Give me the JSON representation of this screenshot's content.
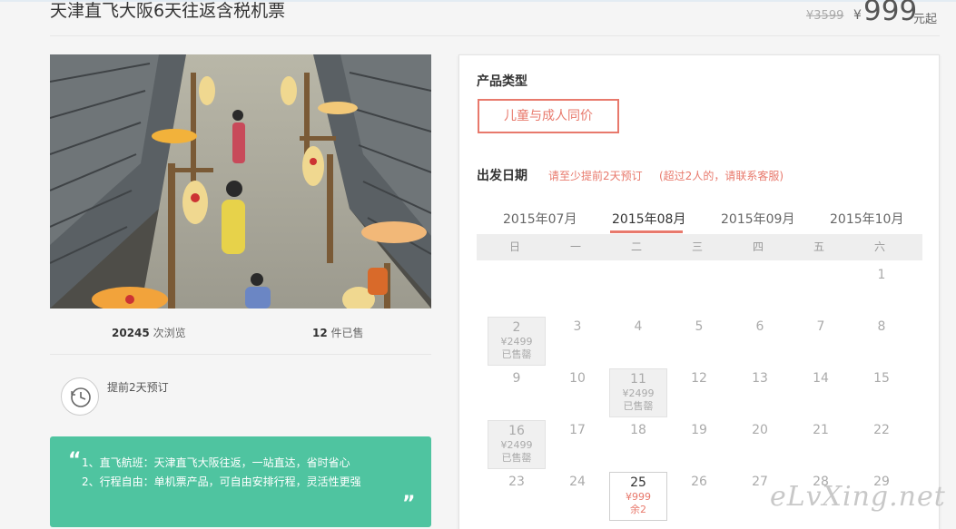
{
  "header": {
    "title": "天津直飞大阪6天往返含税机票",
    "old_price": "¥3599",
    "yen": "¥",
    "price": "999",
    "price_unit": "元起"
  },
  "stats": {
    "views_num": "20245",
    "views_label": " 次浏览",
    "sold_num": "12",
    "sold_label": " 件已售"
  },
  "booking": {
    "note": "提前2天预订",
    "icon": "clock-icon"
  },
  "features": {
    "open_quote": "“",
    "close_quote": "”",
    "line1": "1、直飞航班：天津直飞大阪往返，一站直达，省时省心",
    "line2": "2、行程自由：单机票产品，可自由安排行程，灵活性更强"
  },
  "product": {
    "type_label": "产品类型",
    "type_option": "儿童与成人同价",
    "date_label": "出发日期",
    "date_note1": "请至少提前2天预订",
    "date_note2": "(超过2人的，请联系客服)"
  },
  "calendar": {
    "months": [
      "2015年07月",
      "2015年08月",
      "2015年09月",
      "2015年10月"
    ],
    "active_month": "2015年08月",
    "weekdays": [
      "日",
      "一",
      "二",
      "三",
      "四",
      "五",
      "六"
    ],
    "days": [
      {
        "day": "1"
      },
      {
        "day": "2",
        "price": "¥2499",
        "status": "已售罄"
      },
      {
        "day": "3"
      },
      {
        "day": "4"
      },
      {
        "day": "5"
      },
      {
        "day": "6"
      },
      {
        "day": "7"
      },
      {
        "day": "8"
      },
      {
        "day": "9"
      },
      {
        "day": "10"
      },
      {
        "day": "11",
        "price": "¥2499",
        "status": "已售罄"
      },
      {
        "day": "12"
      },
      {
        "day": "13"
      },
      {
        "day": "14"
      },
      {
        "day": "15"
      },
      {
        "day": "16",
        "price": "¥2499",
        "status": "已售罄"
      },
      {
        "day": "17"
      },
      {
        "day": "18"
      },
      {
        "day": "19"
      },
      {
        "day": "20"
      },
      {
        "day": "21"
      },
      {
        "day": "22"
      },
      {
        "day": "23"
      },
      {
        "day": "24"
      },
      {
        "day": "25",
        "price": "¥999",
        "status": "余2"
      },
      {
        "day": "26"
      },
      {
        "day": "27"
      },
      {
        "day": "28"
      },
      {
        "day": "29"
      }
    ]
  },
  "watermark": "eLvXing.net",
  "colors": {
    "accent": "#e8796c",
    "feature_bg": "#4fc4a0"
  }
}
